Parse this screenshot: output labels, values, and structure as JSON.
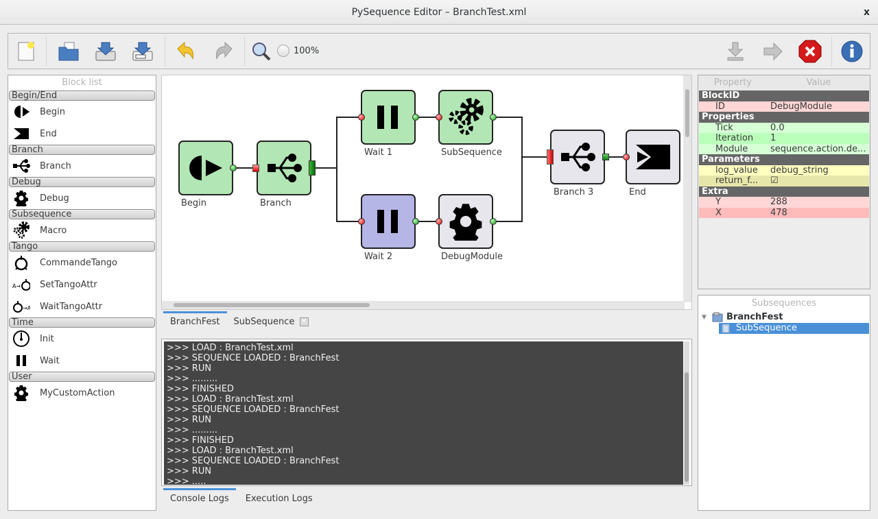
{
  "window": {
    "title": "PySequence Editor – BranchTest.xml",
    "close_label": "x"
  },
  "toolbar": {
    "buttons": [
      "new-file",
      "open-file",
      "save-file",
      "save-as-file",
      "undo",
      "redo",
      "zoom"
    ],
    "zoom_level": "100%",
    "right_buttons": [
      "load",
      "run",
      "stop",
      "about"
    ]
  },
  "block_list": {
    "title": "Block list",
    "categories": [
      {
        "name": "Begin/End",
        "items": [
          "Begin",
          "End"
        ]
      },
      {
        "name": "Branch",
        "items": [
          "Branch"
        ]
      },
      {
        "name": "Debug",
        "items": [
          "Debug"
        ]
      },
      {
        "name": "Subsequence",
        "items": [
          "Macro"
        ]
      },
      {
        "name": "Tango",
        "items": [
          "CommandeTango",
          "SetTangoAttr",
          "WaitTangoAttr"
        ]
      },
      {
        "name": "Time",
        "items": [
          "Init",
          "Wait"
        ]
      },
      {
        "name": "User",
        "items": [
          "MyCustomAction"
        ]
      }
    ]
  },
  "canvas": {
    "nodes": {
      "begin": "Begin",
      "branch": "Branch",
      "wait1": "Wait 1",
      "subsequence": "SubSequence",
      "wait2": "Wait 2",
      "debugmodule": "DebugModule",
      "branch3": "Branch 3",
      "end": "End"
    }
  },
  "editor_tabs": [
    {
      "label": "BranchFest",
      "active": true
    },
    {
      "label": "SubSequence",
      "closable": true
    }
  ],
  "console": {
    "lines": [
      ">>> LOAD : BranchTest.xml",
      ">>> SEQUENCE LOADED : BranchFest",
      ">>> RUN",
      ">>> .........",
      ">>> FINISHED",
      ">>> LOAD : BranchTest.xml",
      ">>> SEQUENCE LOADED : BranchFest",
      ">>> RUN",
      ">>> .........",
      ">>> FINISHED",
      ">>> LOAD : BranchTest.xml",
      ">>> SEQUENCE LOADED : BranchFest",
      ">>> RUN",
      ">>> ....."
    ]
  },
  "log_tabs": [
    {
      "label": "Console Logs",
      "active": true
    },
    {
      "label": "Execution Logs"
    }
  ],
  "properties": {
    "header": {
      "property": "Property",
      "value": "Value"
    },
    "groups": [
      {
        "name": "BlockID",
        "rows": [
          {
            "key": "ID",
            "value": "DebugModule",
            "color": "#ffd6d6"
          }
        ]
      },
      {
        "name": "Properties",
        "rows": [
          {
            "key": "Tick",
            "value": "0.0",
            "color": "#d6ffd6"
          },
          {
            "key": "Iteration",
            "value": "1",
            "color": "#baffba"
          },
          {
            "key": "Module",
            "value": "sequence.action.de...",
            "color": "#d6ffd6"
          }
        ]
      },
      {
        "name": "Parameters",
        "rows": [
          {
            "key": "log_value",
            "value": "debug_string",
            "color": "#ffffc0"
          },
          {
            "key": "return_f...",
            "value": "☑",
            "color": "#e6e6aa",
            "checkbox": true
          }
        ]
      },
      {
        "name": "Extra",
        "rows": [
          {
            "key": "Y",
            "value": "288",
            "color": "#ffd6d6"
          },
          {
            "key": "X",
            "value": "478",
            "color": "#ffbaba"
          }
        ]
      }
    ]
  },
  "subsequences": {
    "title": "Subsequences",
    "root": "BranchFest",
    "children": [
      "SubSequence"
    ],
    "selected": "SubSequence",
    "selection_color": "#4a90d9"
  }
}
